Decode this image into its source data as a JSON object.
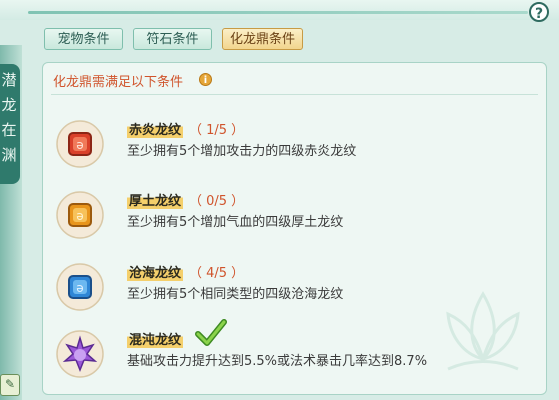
{
  "sidebar": {
    "title_chars": [
      "潜",
      "龙",
      "在",
      "渊"
    ]
  },
  "tabs": [
    {
      "label": "宠物条件",
      "active": false
    },
    {
      "label": "符石条件",
      "active": false
    },
    {
      "label": "化龙鼎条件",
      "active": true
    }
  ],
  "panel": {
    "title": "化龙鼎需满足以下条件",
    "conditions": [
      {
        "name": "赤炎龙纹",
        "progress": "（ 1/5 ）",
        "desc": "至少拥有5个增加攻击力的四级赤炎龙纹",
        "gem_icon": "red-gem-icon",
        "color": "#d9402a"
      },
      {
        "name": "厚土龙纹",
        "progress": "（ 0/5 ）",
        "desc": "至少拥有5个增加气血的四级厚土龙纹",
        "gem_icon": "orange-gem-icon",
        "color": "#e8951c"
      },
      {
        "name": "沧海龙纹",
        "progress": "（ 4/5 ）",
        "desc": "至少拥有5个相同类型的四级沧海龙纹",
        "gem_icon": "blue-gem-icon",
        "color": "#2f86d6"
      },
      {
        "name": "混沌龙纹",
        "completed": true,
        "desc": "基础攻击力提升达到5.5%或法术暴击几率达到8.7%",
        "gem_icon": "purple-gem-icon",
        "color": "#9b58d8"
      }
    ]
  },
  "colors": {
    "accent": "#d0542c",
    "tab_active_bg": "#f2d58e",
    "panel_bg": "#eef7f3"
  }
}
